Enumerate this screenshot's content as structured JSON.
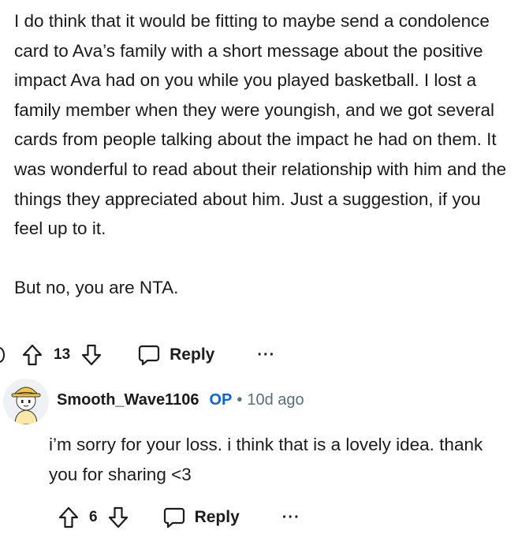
{
  "comment": {
    "paragraphs": [
      "I do think that it would be fitting to maybe send a condolence card to Ava’s family with a short message about the positive impact Ava had on you while you played basketball. I lost a family member when they were youngish, and we got several cards from people talking about the impact he had on them. It was wonderful to read about their relationship with him and the things they appreciated about him. Just a suggestion, if you feel up to it.",
      "But no, you are NTA."
    ],
    "vote_count": "13",
    "reply_label": "Reply",
    "more_label": "···"
  },
  "reply": {
    "username": "Smooth_Wave1106",
    "op_tag": "OP",
    "separator": "•",
    "timestamp": "10d ago",
    "text": "i’m sorry for your loss. i think that is a lovely idea. thank you for sharing <3",
    "vote_count": "6",
    "reply_label": "Reply",
    "more_label": "···"
  },
  "colors": {
    "op_blue": "#0a66d8",
    "meta_gray": "#576f76",
    "text": "#1a1a1a"
  },
  "icons": [
    "upvote-icon",
    "downvote-icon",
    "comment-bubble-icon",
    "more-icon",
    "avatar"
  ]
}
